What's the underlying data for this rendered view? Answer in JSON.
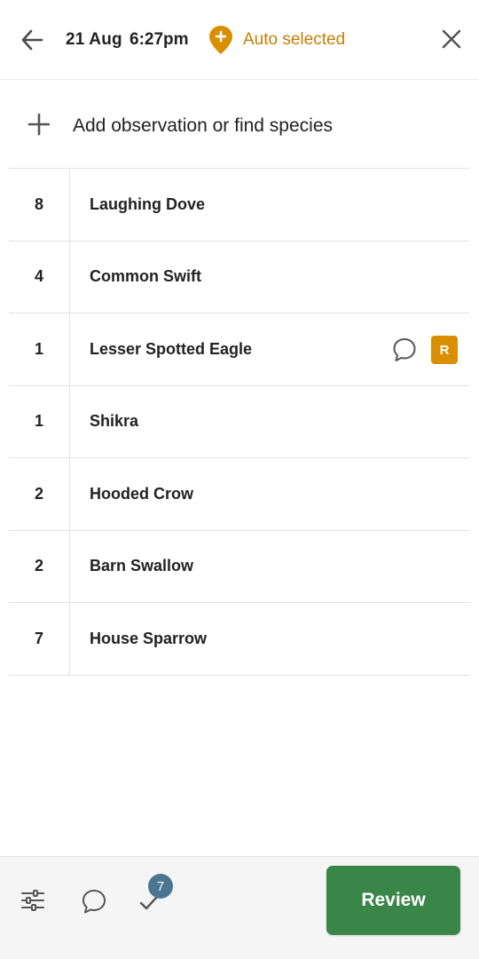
{
  "header": {
    "date": "21 Aug",
    "time": "6:27pm",
    "location_label": "Auto selected",
    "back_icon": "arrow-left-icon",
    "close_icon": "close-icon",
    "location_icon": "location-pin-plus-icon"
  },
  "add_row": {
    "label": "Add observation or find species",
    "icon": "plus-icon"
  },
  "observations": [
    {
      "count": "8",
      "species": "Laughing Dove",
      "has_comment": false,
      "badge": ""
    },
    {
      "count": "4",
      "species": "Common Swift",
      "has_comment": false,
      "badge": ""
    },
    {
      "count": "1",
      "species": "Lesser Spotted Eagle",
      "has_comment": true,
      "badge": "R"
    },
    {
      "count": "1",
      "species": "Shikra",
      "has_comment": false,
      "badge": ""
    },
    {
      "count": "2",
      "species": "Hooded Crow",
      "has_comment": false,
      "badge": ""
    },
    {
      "count": "2",
      "species": "Barn Swallow",
      "has_comment": false,
      "badge": ""
    },
    {
      "count": "7",
      "species": "House Sparrow",
      "has_comment": false,
      "badge": ""
    }
  ],
  "bottom_bar": {
    "checklist_count": "7",
    "review_label": "Review",
    "filter_icon": "sliders-icon",
    "comment_icon": "comment-icon",
    "check_icon": "checkmark-icon"
  },
  "colors": {
    "accent_orange": "#c67d00",
    "badge_orange": "#d98f00",
    "review_green": "#3a8548",
    "count_badge_blue": "#4a7692"
  }
}
